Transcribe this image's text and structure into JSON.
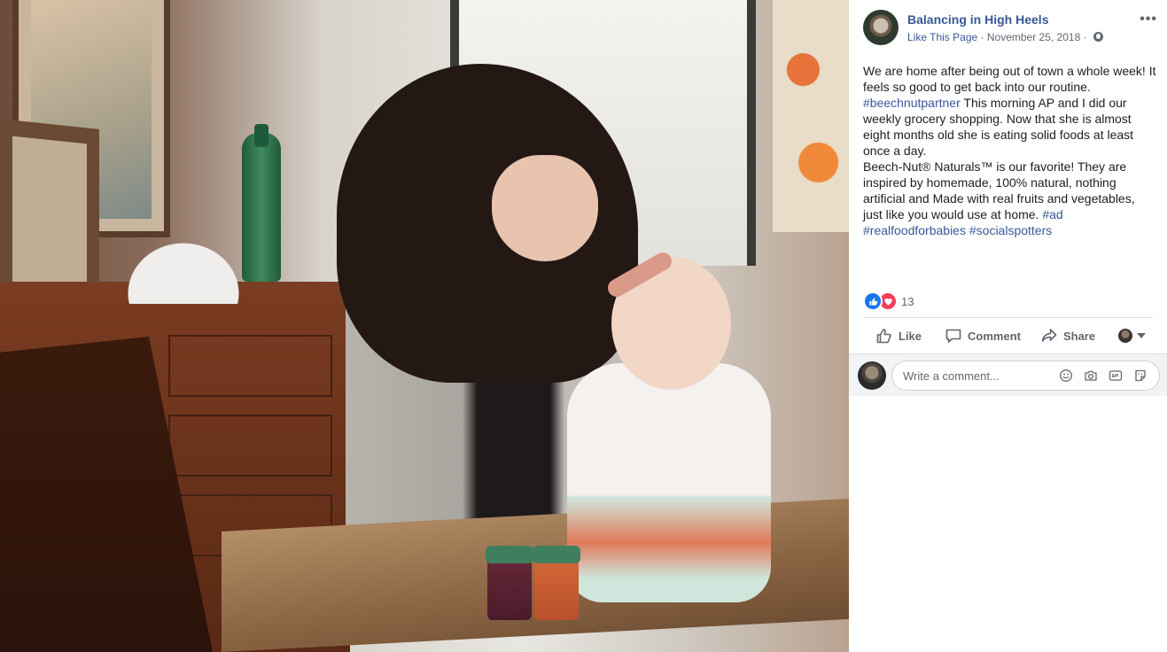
{
  "post": {
    "page_name": "Balancing in High Heels",
    "like_page": "Like This Page",
    "separator": "·",
    "date": "November 25, 2018",
    "more": "•••",
    "text": {
      "p1": "We are home after being out of town a whole week! It feels so good to get back into our routine.",
      "tag_beechnut": "#beechnutpartner",
      "p1b": "This morning AP and I did our weekly grocery shopping. Now that she is almost eight months old she is eating solid foods at least once a day.",
      "p2": "Beech-Nut® Naturals™ is our favorite! They are inspired by homemade, 100% natural, nothing artificial and Made with real fruits and vegetables, just like you would use at home.",
      "tag_ad": "#ad",
      "tag_realfood": "#realfoodforbabies",
      "tag_socialspotters": "#socialspotters"
    },
    "reactions": {
      "count": "13",
      "types": [
        "like",
        "love"
      ]
    }
  },
  "actions": {
    "like": "Like",
    "comment": "Comment",
    "share": "Share"
  },
  "comment_box": {
    "placeholder": "Write a comment...",
    "icons": [
      "emoji-icon",
      "camera-icon",
      "gif-icon",
      "sticker-icon"
    ]
  },
  "colors": {
    "link": "#385898",
    "secondary_text": "#606770",
    "like_blue": "#1877f2",
    "love_red": "#f33e58"
  }
}
